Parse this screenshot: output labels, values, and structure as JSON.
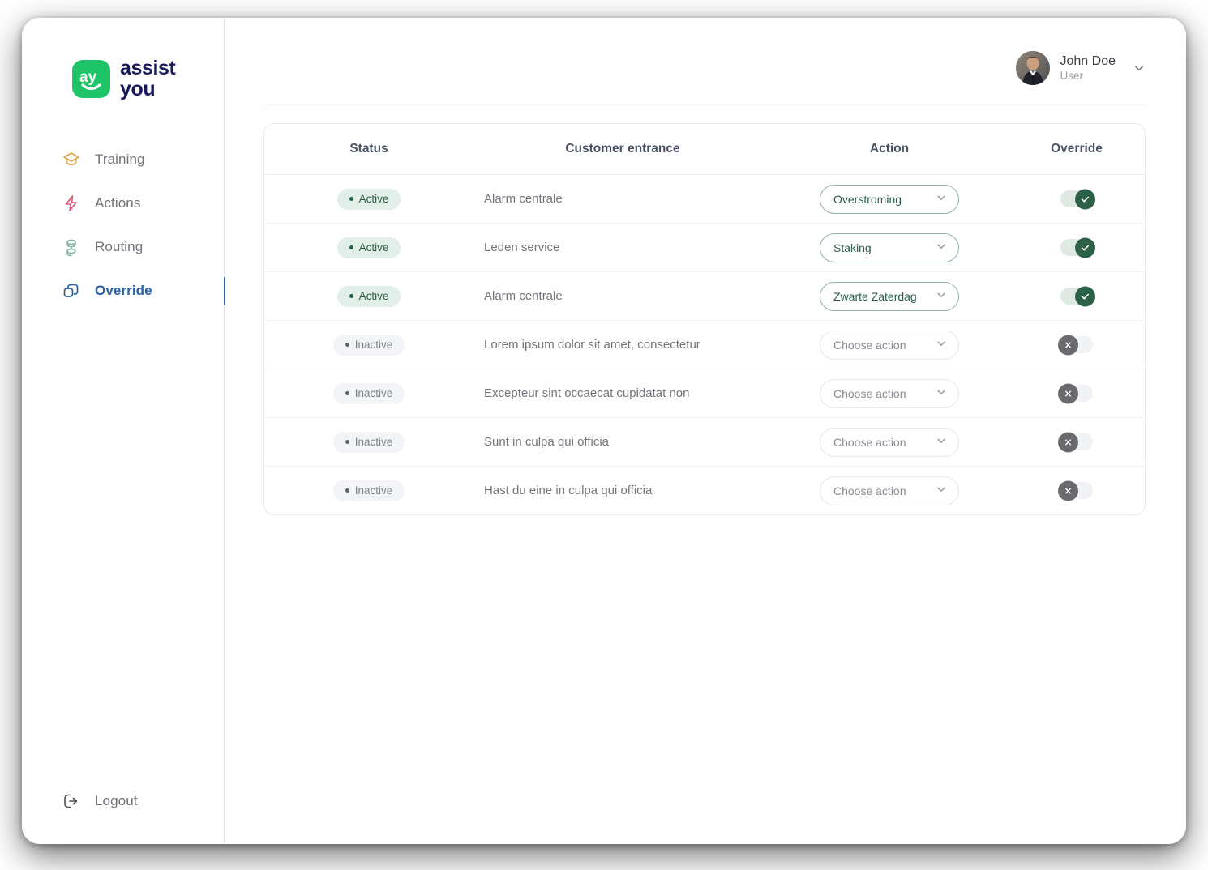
{
  "brand": {
    "logo_icon": "ay-logo-icon",
    "name_line1": "assist",
    "name_line2": "you",
    "logo_green": "#20c468",
    "wordmark_navy": "#18195a"
  },
  "sidebar": {
    "items": [
      {
        "label": "Training",
        "icon": "graduation-cap-icon",
        "color": "#e8a33d",
        "active": false
      },
      {
        "label": "Actions",
        "icon": "lightning-bolt-icon",
        "color": "#e05573",
        "active": false
      },
      {
        "label": "Routing",
        "icon": "routing-nodes-icon",
        "color": "#84b3a2",
        "active": false
      },
      {
        "label": "Override",
        "icon": "layers-copy-icon",
        "color": "#2a62a3",
        "active": true
      }
    ],
    "logout": {
      "label": "Logout",
      "icon": "logout-icon"
    },
    "active_accent": "#2a62a3"
  },
  "topbar": {
    "user_name": "John Doe",
    "user_role": "User",
    "avatar_icon": "user-avatar-photo",
    "chevron_icon": "chevron-down-icon"
  },
  "table": {
    "headers": {
      "status": "Status",
      "entrance": "Customer entrance",
      "action": "Action",
      "override": "Override"
    },
    "action_placeholder": "Choose action",
    "status_labels": {
      "active": "Active",
      "inactive": "Inactive"
    },
    "rows": [
      {
        "status": "Active",
        "entrance": "Alarm centrale",
        "action": "Overstroming",
        "override": true
      },
      {
        "status": "Active",
        "entrance": "Leden service",
        "action": "Staking",
        "override": true
      },
      {
        "status": "Active",
        "entrance": "Alarm centrale",
        "action": "Zwarte Zaterdag",
        "override": true
      },
      {
        "status": "Inactive",
        "entrance": "Lorem ipsum dolor sit amet, consectetur",
        "action": "Choose action",
        "override": false
      },
      {
        "status": "Inactive",
        "entrance": "Excepteur sint occaecat cupidatat non",
        "action": "Choose action",
        "override": false
      },
      {
        "status": "Inactive",
        "entrance": "Sunt in culpa qui officia",
        "action": "Choose action",
        "override": false
      },
      {
        "status": "Inactive",
        "entrance": "Hast du eine in culpa qui officia",
        "action": "Choose action",
        "override": false
      }
    ]
  },
  "colors": {
    "active_badge_bg": "#e2eee8",
    "active_badge_text": "#29614a",
    "inactive_badge_bg": "#f3f4f7",
    "inactive_badge_text": "#7e8288",
    "toggle_on": "#2c6148",
    "toggle_off": "#6a6b6e",
    "select_border_active": "#93b2a3"
  }
}
